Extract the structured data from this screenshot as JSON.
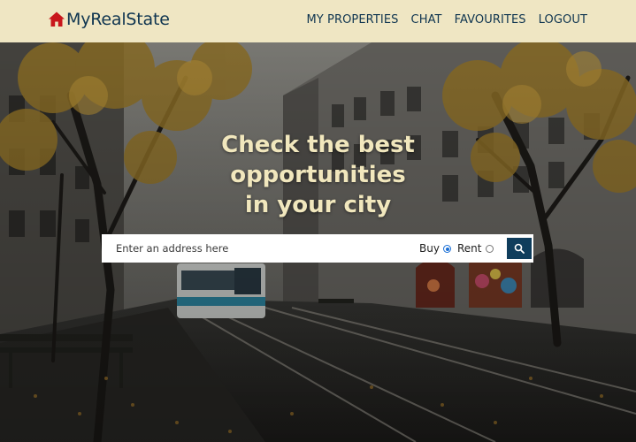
{
  "brand": {
    "name": "MyRealState",
    "icon": "home-icon",
    "icon_color": "#c8171c",
    "text_color": "#0f3550"
  },
  "nav": {
    "items": [
      {
        "label": "MY PROPERTIES"
      },
      {
        "label": "CHAT"
      },
      {
        "label": "FAVOURITES"
      },
      {
        "label": "LOGOUT"
      }
    ],
    "background": "#efe6c3"
  },
  "hero": {
    "headline": [
      "Check the best",
      "opportunities",
      "in your city"
    ],
    "headline_color": "#f1e7bd"
  },
  "search": {
    "placeholder": "Enter an address here",
    "value": "",
    "options": [
      {
        "label": "Buy",
        "checked": true
      },
      {
        "label": "Rent",
        "checked": false
      }
    ],
    "button_icon": "search-icon",
    "button_color": "#0f3d5c"
  }
}
